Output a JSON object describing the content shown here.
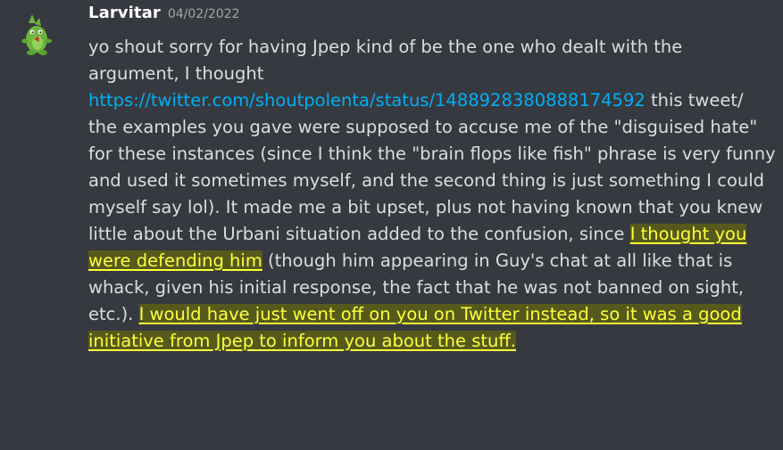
{
  "message": {
    "username": "Larvitar",
    "timestamp": "04/02/2022",
    "text_part1": "yo shout sorry for having Jpep kind of be the one who dealt with the argument, I thought ",
    "link": "https://twitter.com/shoutpolenta/status/1488928380888174592",
    "text_part2": " this tweet/ the examples you gave were supposed to accuse me of the \"disguised hate\" for these instances (since I think the \"brain flops like fish\" phrase is very funny and used it sometimes myself, and the second thing is just something I could myself say lol). It made me a bit upset, plus not having known that you knew little about the Urbani situation added to the confusion, since ",
    "highlight1": "I thought you were defending him",
    "text_part3": " (though him appearing in Guy's chat at all like that is whack, given his initial response, the fact that he was not banned on sight, etc.). ",
    "highlight2": "I would have just went off on you on Twitter instead, so it was a good initiative from Jpep to inform you about the stuff."
  },
  "colors": {
    "background": "#36393f",
    "link": "#00aff4",
    "highlight_text": "#ffff3a",
    "highlight_bg": "#555a1c",
    "avatar_green": "#6cb43f"
  },
  "icons": {
    "avatar": "larvitar-avatar-icon"
  }
}
